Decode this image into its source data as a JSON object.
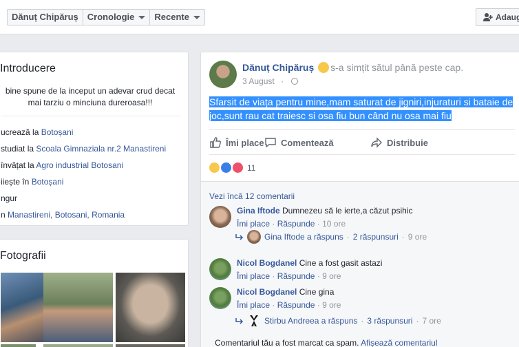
{
  "nav": {
    "name": "Dănuț Chipăruș",
    "timeline": "Cronologie",
    "recent": "Recente",
    "add": "Adaug"
  },
  "intro": {
    "title": "Introducere",
    "bio": "bine spune de la inceput un adevar crud decat mai tarziu o minciuna dureroasa!!!",
    "rows": [
      {
        "prefix": "ucrează la ",
        "link": "Botoșani"
      },
      {
        "prefix": "studiat la ",
        "link": "Scoala Gimnaziala nr.2 Manastireni"
      },
      {
        "prefix": "învățat la ",
        "link": "Agro industrial Botosani"
      },
      {
        "prefix": "iiește în ",
        "link": "Botoșani"
      },
      {
        "prefix": "ngur",
        "link": ""
      },
      {
        "prefix": "n ",
        "link": "Manastireni, Botosani, Romania"
      }
    ]
  },
  "photos": {
    "title": "Fotografii"
  },
  "post": {
    "author": "Dănuț Chipăruș",
    "feeling": "s-a simțit sătul până peste cap.",
    "date": "3 August",
    "date_sep": "·",
    "line1": "Sfarsit de viața pentru mine,mam saturat de jigniri,injuraturi si bataie de",
    "line2": "joc,sunt rau cat traiesc si osa fiu bun când nu osa mai fiu",
    "like": "Îmi place",
    "comment": "Comentează",
    "share": "Distribuie",
    "reaction_count": "11"
  },
  "comments": {
    "more": "Vezi încă 12 comentarii",
    "items": [
      {
        "name": "Gina Iftode",
        "text": "Dumnezeu să le ierte,a căzut psihic",
        "like": "Îmi place",
        "reply": "Răspunde",
        "time": "10 ore",
        "sep": "·",
        "replies_text": "Gina Iftode a răspuns",
        "replies_count": "2 răspunsuri",
        "replies_time": "9 ore"
      },
      {
        "name": "Nicol Bogdanel",
        "text": "Cine a fost gasit astazi",
        "like": "Îmi place",
        "reply": "Răspunde",
        "time": "9 ore",
        "sep": "·"
      },
      {
        "name": "Nicol Bogdanel",
        "text": "Cine gina",
        "like": "Îmi place",
        "reply": "Răspunde",
        "time": "9 ore",
        "sep": "·",
        "replies_text": "Stirbu Andreea a răspuns",
        "replies_count": "3 răspunsuri",
        "replies_time": "7 ore"
      }
    ],
    "spam_text": "Comentariul tău a fost marcat ca spam.",
    "spam_link": "Afișează comentariul"
  },
  "colors": {
    "link": "#365899",
    "highlight": "#3390ff",
    "muted": "#90949c"
  }
}
